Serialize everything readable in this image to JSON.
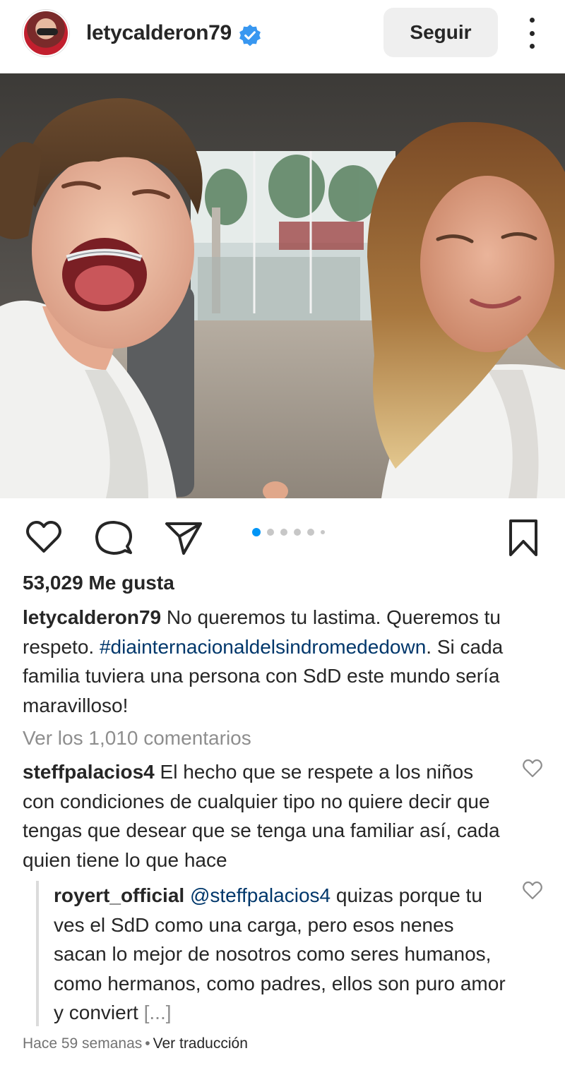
{
  "header": {
    "username": "letycalderon79",
    "follow_label": "Seguir",
    "icons": {
      "avatar": "profile-avatar",
      "verified": "verified-badge-icon",
      "more": "more-vertical-icon"
    },
    "verified_color": "#3897f0"
  },
  "post": {
    "carousel": {
      "count": 6,
      "active_index": 0
    }
  },
  "actions": {
    "icons": [
      "heart-icon",
      "comment-icon",
      "share-icon",
      "bookmark-icon"
    ]
  },
  "likes_label": "53,029 Me gusta",
  "caption": {
    "username": "letycalderon79",
    "text_before": " No queremos tu lastima. Queremos tu respeto. ",
    "hashtag": "#diainternacionaldelsindromededown",
    "text_after": ". Si cada familia tuviera una persona con SdD este mundo sería maravilloso!"
  },
  "view_comments": "Ver los 1,010 comentarios",
  "comments": [
    {
      "username": "steffpalacios4",
      "text": " El hecho que se respete a los niños con condiciones de cualquier tipo no quiere decir que tengas que desear que se tenga una familiar así, cada quien tiene lo que hace"
    }
  ],
  "reply": {
    "username": "royert_official",
    "mention": "@steffpalacios4",
    "text": " quizas porque tu ves el SdD como una carga, pero esos nenes sacan lo mejor de nosotros como seres humanos, como hermanos, como padres, ellos son puro amor y conviert ",
    "ellipsis": "[...]"
  },
  "footer": {
    "time": "Hace 59 semanas",
    "separator": "•",
    "translate": "Ver traducción"
  },
  "colors": {
    "link": "#00376b",
    "muted": "#8e8e8e",
    "accent": "#0095f6"
  }
}
